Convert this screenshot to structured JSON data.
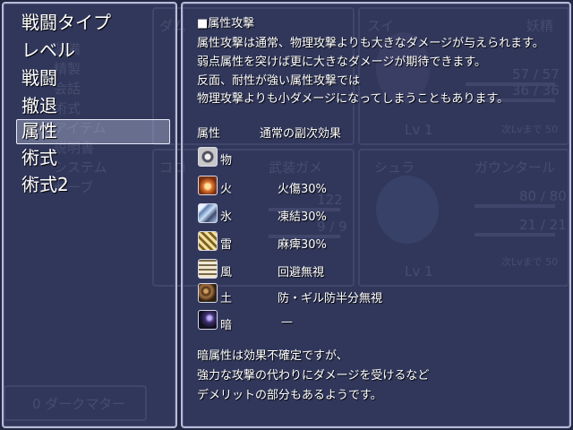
{
  "menu": {
    "items": [
      {
        "label": "戦闘タイプ"
      },
      {
        "label": "レベル"
      },
      {
        "label": "戦闘"
      },
      {
        "label": "撤退"
      },
      {
        "label": "属性",
        "selected": true
      },
      {
        "label": "術式"
      },
      {
        "label": "術式2"
      }
    ]
  },
  "help": {
    "heading": "■属性攻撃",
    "intro": [
      "属性攻撃は通常、物理攻撃よりも大きなダメージが与えられます。",
      "弱点属性を突けば更に大きなダメージが期待できます。",
      "反面、耐性が強い属性攻撃では",
      "物理攻撃よりも小ダメージになってしまうこともあります。"
    ],
    "table_header": {
      "element": "属性",
      "effect": "通常の副次効果"
    },
    "elements": [
      {
        "name": "物",
        "effect": "",
        "icon": "physical-icon",
        "color": "#d8d8d8"
      },
      {
        "name": "火",
        "effect": "火傷30%",
        "icon": "fire-icon",
        "color": "#e07830"
      },
      {
        "name": "氷",
        "effect": "凍結30%",
        "icon": "ice-icon",
        "color": "#a8d0f0"
      },
      {
        "name": "雷",
        "effect": "麻痺30%",
        "icon": "thunder-icon",
        "color": "#e8c850"
      },
      {
        "name": "風",
        "effect": "回避無視",
        "icon": "wind-icon",
        "color": "#d8c8a0"
      },
      {
        "name": "土",
        "effect": "防・ギル防半分無視",
        "icon": "earth-icon",
        "color": "#a07040"
      },
      {
        "name": "暗",
        "effect": "—",
        "icon": "dark-icon",
        "color": "#7060b0"
      }
    ],
    "footer": [
      "暗属性は効果不確定ですが、",
      "強力な攻撃の代わりにダメージを受けるなど",
      "デメリットの部分もあるようです。"
    ]
  },
  "background": {
    "menu_items": [
      "装備",
      "精製",
      "会話",
      "術式",
      "アイテム",
      "説明書",
      "システム",
      "セーブ"
    ],
    "currency": "0 ダークマター",
    "party": [
      {
        "name": "ダム"
      },
      {
        "name": "スイ",
        "title": "妖精",
        "life": "57 / 57",
        "mental": "36 / 36",
        "level": "Lv 1",
        "next": "次Lvまで 50"
      },
      {
        "name": "コロ",
        "title": "武装ガメ",
        "life": "122",
        "mental": "9 / 9"
      },
      {
        "name": "シュラ",
        "level": "Lv 1"
      },
      {
        "name": "ガウンタール",
        "life": "80 / 80",
        "mental": "21 / 21",
        "next": "次Lvまで 50"
      }
    ]
  }
}
